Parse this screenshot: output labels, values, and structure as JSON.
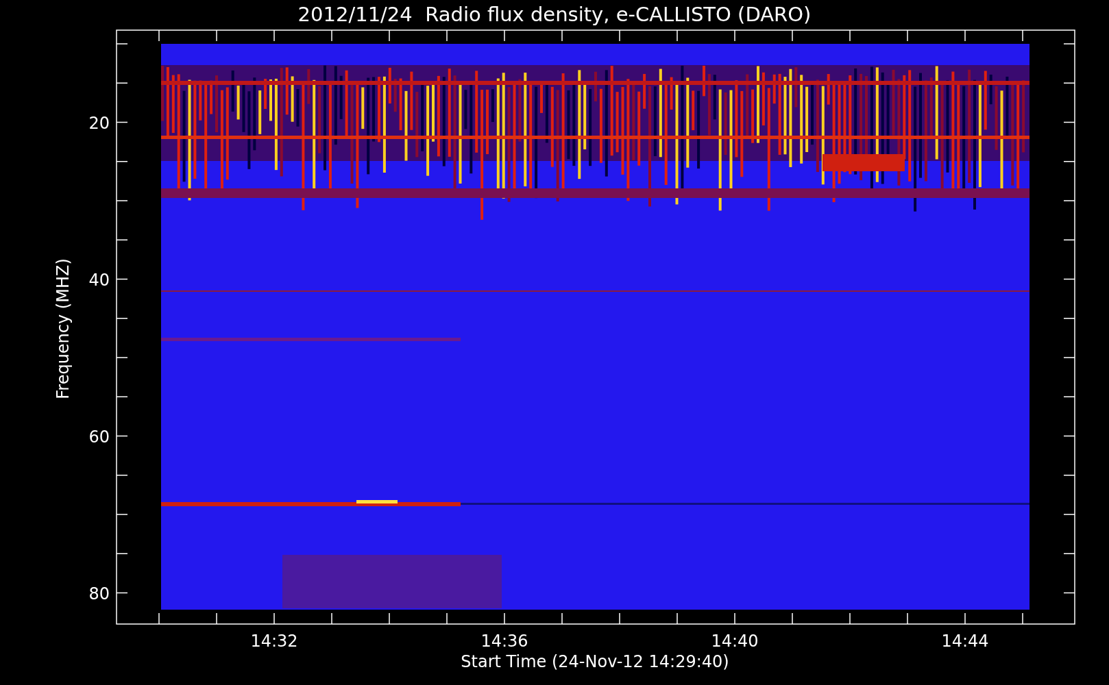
{
  "title": "2012/11/24  Radio flux density, e-CALLISTO (DARO)",
  "plot": {
    "ylabel": "Frequency (MHZ)",
    "xlabel": "Start Time (24-Nov-12 14:29:40)",
    "yticks": [
      "20",
      "40",
      "60",
      "80"
    ],
    "xticks": [
      "14:32",
      "14:36",
      "14:40",
      "14:44"
    ]
  }
}
